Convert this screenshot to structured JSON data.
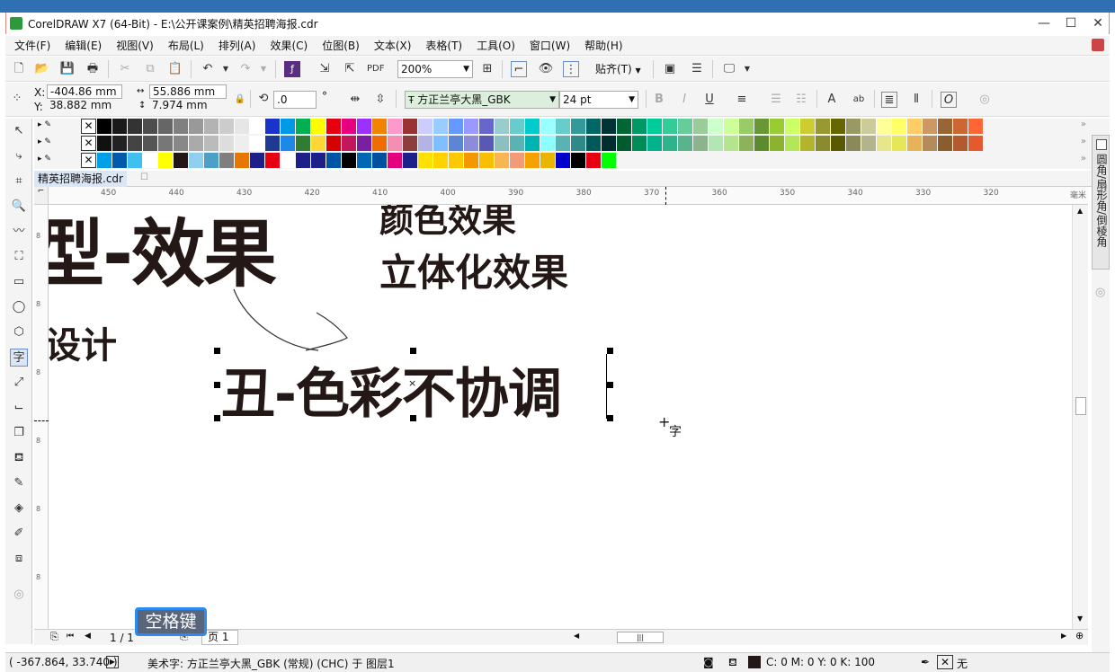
{
  "window": {
    "title": "CorelDRAW X7 (64-Bit) - E:\\公开课案例\\精英招聘海报.cdr"
  },
  "menu": [
    "文件(F)",
    "编辑(E)",
    "视图(V)",
    "布局(L)",
    "排列(A)",
    "效果(C)",
    "位图(B)",
    "文本(X)",
    "表格(T)",
    "工具(O)",
    "窗口(W)",
    "帮助(H)"
  ],
  "standard_toolbar": {
    "zoom": "200%",
    "snap": "贴齐(T)"
  },
  "property_bar": {
    "x": "-404.86 mm",
    "y": "38.882 mm",
    "x_label": "X:",
    "y_label": "Y:",
    "width": "55.886 mm",
    "height": "7.974 mm",
    "rotation": ".0",
    "degree": "°",
    "font": "方正兰亭大黑_GBK",
    "font_size": "24 pt"
  },
  "document_tab": "精英招聘海报.cdr",
  "ruler": {
    "unit": "毫米",
    "ticks": [
      "450",
      "440",
      "430",
      "420",
      "410",
      "400",
      "390",
      "380",
      "370",
      "360",
      "350",
      "340",
      "330",
      "320"
    ]
  },
  "canvas": {
    "line1a": "型-效果",
    "line1b": "颜色效果",
    "line1c": "立体化效果",
    "line2": "设计",
    "selected_text": "丑-色彩不协调",
    "cursor_label": "字"
  },
  "docker_label": "圆角/扇形角/倒棱角",
  "page_nav": {
    "count": "1 / 1",
    "page_tab": "页 1"
  },
  "key_overlay": "空格键",
  "status": {
    "coords": "( -367.864, 33.740 )",
    "description": "美术字: 方正兰亭大黑_GBK (常规) (CHC) 于 图层1",
    "fill": "C: 0 M: 0 Y: 0 K: 100",
    "outline": "无"
  },
  "palette_rows": [
    [
      "#000000",
      "#1a1a1a",
      "#333333",
      "#4d4d4d",
      "#666666",
      "#808080",
      "#999999",
      "#b3b3b3",
      "#cccccc",
      "#e6e6e6",
      "#ffffff",
      "#1a33cc",
      "#0099e6",
      "#00b050",
      "#ffff00",
      "#e60012",
      "#e4007f",
      "#9b30ff",
      "#f08300",
      "#ff99cc",
      "#993333",
      "#ccccff",
      "#99ccff",
      "#6699ff",
      "#9999ff",
      "#6666cc",
      "#99cccc",
      "#66cccc",
      "#00cccc",
      "#99ffff",
      "#66cccc",
      "#339999",
      "#006666",
      "#003333",
      "#006633",
      "#009966",
      "#00cc99",
      "#33cc99",
      "#66cc99",
      "#99cc99",
      "#ccffcc",
      "#ccff99",
      "#99cc66",
      "#669933",
      "#99cc33",
      "#ccff66",
      "#cccc33",
      "#999933",
      "#666600",
      "#999966",
      "#cccc99",
      "#ffff99",
      "#ffff66",
      "#ffcc66",
      "#cc9966",
      "#996633",
      "#cc6633",
      "#ff6633"
    ],
    [
      "#111111",
      "#222222",
      "#444444",
      "#555555",
      "#777777",
      "#888888",
      "#aaaaaa",
      "#bbbbbb",
      "#dddddd",
      "#eeeeee",
      "#ffffff",
      "#1f3a93",
      "#1e88e5",
      "#2e7d32",
      "#fdd835",
      "#d50000",
      "#c2185b",
      "#7b1fa2",
      "#ef6c00",
      "#f48fb1",
      "#8d3d3d",
      "#b3b3e6",
      "#80bfff",
      "#5c85d6",
      "#8c8cd9",
      "#5959b3",
      "#8cbfbf",
      "#59b3b3",
      "#00b3b3",
      "#8cffff",
      "#59b3b3",
      "#2e8a8a",
      "#005959",
      "#002e2e",
      "#005c2e",
      "#008c59",
      "#00b38c",
      "#2eb38c",
      "#59b38c",
      "#8cb38c",
      "#b3e6b3",
      "#b3e68c",
      "#8cb359",
      "#5c8a2e",
      "#8cb32e",
      "#b3e659",
      "#b3b32e",
      "#8a8a2e",
      "#595900",
      "#8a8a59",
      "#b3b38c",
      "#e6e68c",
      "#e6e659",
      "#e6b359",
      "#b38c59",
      "#8a5c2e",
      "#b3592e",
      "#e6592e"
    ],
    [
      "#00a0e9",
      "#005bac",
      "#40c0f0",
      "#ffffff",
      "#ffff00",
      "#231815",
      "#8fd0f0",
      "#4aa0c8",
      "#7f7f7f",
      "#e87700",
      "#1d2088",
      "#e60012",
      "#ffffff",
      "#1d2088",
      "#1d2088",
      "#0054a6",
      "#000000",
      "#0068b7",
      "#0050a0",
      "#e4007f",
      "#1d2088",
      "#ffe100",
      "#ffd200",
      "#fcc800",
      "#f39800",
      "#fabe00",
      "#f8b551",
      "#f29b76",
      "#f5a200",
      "#eab500",
      "#0000cc",
      "#000000",
      "#e60012",
      "#00ff00"
    ]
  ]
}
